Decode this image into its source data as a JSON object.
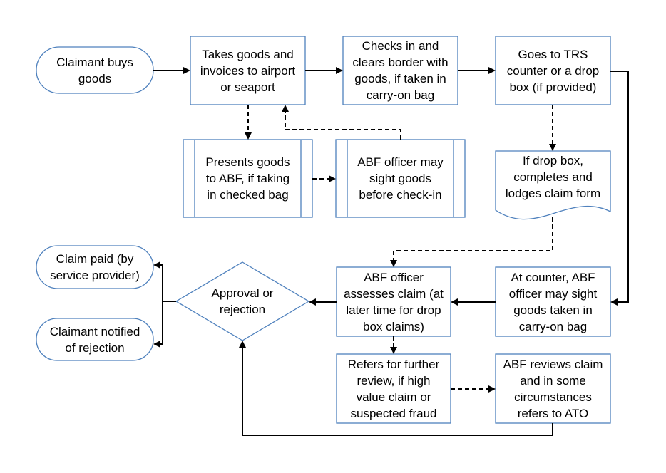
{
  "diagram": {
    "nodes": {
      "claimant_buys": "Claimant buys\ngoods",
      "takes_goods": "Takes goods and\ninvoices to airport\nor seaport",
      "checks_in": "Checks in and\nclears border with\ngoods, if taken in\ncarry-on bag",
      "goes_to_trs": "Goes to TRS\ncounter or a drop\nbox (if provided)",
      "presents_goods": "Presents goods\nto ABF, if taking\nin checked bag",
      "abf_sight_before": "ABF officer may\nsight goods\nbefore check-in",
      "drop_box_form": "If drop box,\ncompletes and\nlodges claim form",
      "claim_paid": "Claim paid (by\nservice provider)",
      "claimant_notified": "Claimant notified\nof rejection",
      "approval_rejection": "Approval or\nrejection",
      "abf_assesses": "ABF officer\nassesses claim (at\nlater time for drop\nbox claims)",
      "at_counter": "At counter, ABF\nofficer may sight\ngoods taken in\ncarry-on bag",
      "refers_review": "Refers for further\nreview, if high\nvalue claim or\nsuspected fraud",
      "abf_reviews": "ABF reviews claim\nand in some\ncircumstances\nrefers to ATO"
    },
    "edges": [
      {
        "from": "claimant_buys",
        "to": "takes_goods",
        "style": "solid"
      },
      {
        "from": "takes_goods",
        "to": "checks_in",
        "style": "solid"
      },
      {
        "from": "checks_in",
        "to": "goes_to_trs",
        "style": "solid"
      },
      {
        "from": "takes_goods",
        "to": "presents_goods",
        "style": "dashed"
      },
      {
        "from": "presents_goods",
        "to": "abf_sight_before",
        "style": "dashed"
      },
      {
        "from": "abf_sight_before",
        "to": "takes_goods",
        "style": "dashed"
      },
      {
        "from": "goes_to_trs",
        "to": "drop_box_form",
        "style": "dashed"
      },
      {
        "from": "goes_to_trs",
        "to": "at_counter",
        "style": "solid"
      },
      {
        "from": "drop_box_form",
        "to": "abf_assesses",
        "style": "dashed"
      },
      {
        "from": "at_counter",
        "to": "abf_assesses",
        "style": "solid"
      },
      {
        "from": "abf_assesses",
        "to": "approval_rejection",
        "style": "solid"
      },
      {
        "from": "abf_assesses",
        "to": "refers_review",
        "style": "dashed"
      },
      {
        "from": "refers_review",
        "to": "abf_reviews",
        "style": "dashed"
      },
      {
        "from": "abf_reviews",
        "to": "approval_rejection",
        "style": "solid"
      },
      {
        "from": "approval_rejection",
        "to": "claim_paid",
        "style": "solid"
      },
      {
        "from": "approval_rejection",
        "to": "claimant_notified",
        "style": "solid"
      }
    ]
  }
}
